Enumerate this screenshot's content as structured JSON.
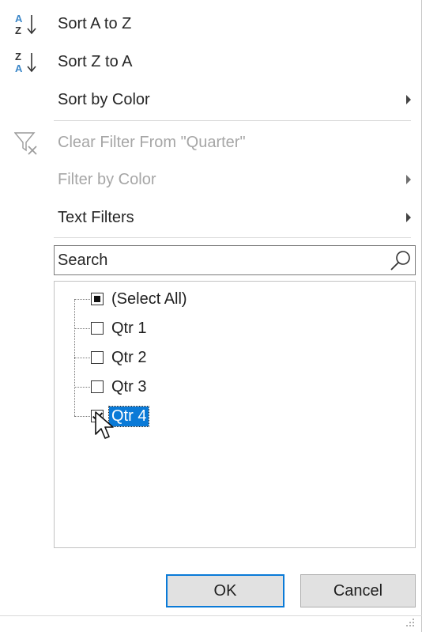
{
  "menu": {
    "sort_az": "Sort A to Z",
    "sort_za": "Sort Z to A",
    "sort_by_color": "Sort by Color",
    "clear_filter": "Clear Filter From \"Quarter\"",
    "filter_by_color": "Filter by Color",
    "text_filters": "Text Filters"
  },
  "search": {
    "placeholder": "Search"
  },
  "tree": {
    "items": [
      {
        "label": "(Select All)",
        "state": "partial"
      },
      {
        "label": "Qtr 1",
        "state": "unchecked"
      },
      {
        "label": "Qtr 2",
        "state": "unchecked"
      },
      {
        "label": "Qtr 3",
        "state": "unchecked"
      },
      {
        "label": "Qtr 4",
        "state": "checked",
        "selected": true
      }
    ]
  },
  "buttons": {
    "ok": "OK",
    "cancel": "Cancel"
  },
  "colors": {
    "accent": "#0a7ad7",
    "disabled_text": "#a6a6a6",
    "icon_blue": "#3a86c8"
  },
  "icons": [
    "sort-az-icon",
    "sort-za-icon",
    "clear-filter-icon",
    "search-icon",
    "submenu-arrow-icon",
    "mouse-cursor-icon",
    "resize-grip-icon"
  ]
}
